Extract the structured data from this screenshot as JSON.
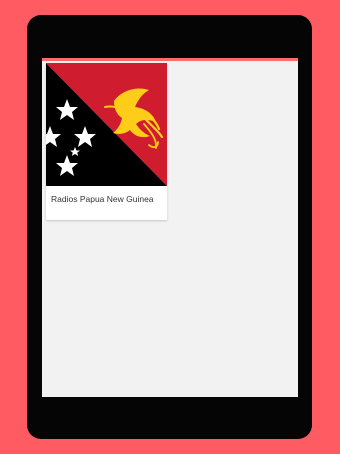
{
  "colors": {
    "page_background": "#ff5b62",
    "device_frame": "#050505",
    "screen_background": "#f2f2f2",
    "accent": "#ff6b6b",
    "flag_red": "#d01c2f",
    "flag_black": "#000000",
    "flag_gold": "#ffcc1a",
    "star_white": "#ffffff"
  },
  "station_list": {
    "items": [
      {
        "title": "Radios Papua New Guinea",
        "flag_icon": "papua-new-guinea-flag-icon"
      }
    ]
  }
}
